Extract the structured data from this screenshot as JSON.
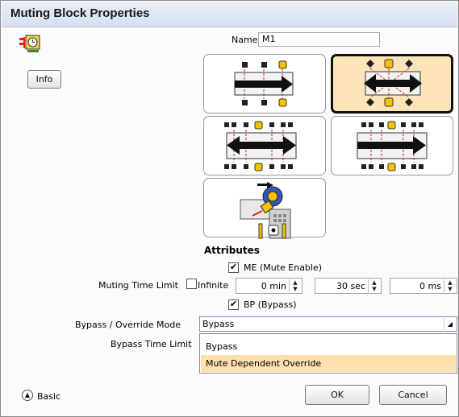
{
  "window": {
    "title": "Muting Block Properties"
  },
  "info_button": "Info",
  "name": {
    "label": "Name",
    "value": "M1"
  },
  "attributes": {
    "heading": "Attributes",
    "mute_enable": {
      "label": "ME (Mute Enable)",
      "checked": true
    },
    "muting_time_limit": {
      "label": "Muting Time Limit",
      "infinite_label": "Infinite",
      "infinite_checked": false,
      "minutes": "0 min",
      "seconds": "30 sec",
      "milliseconds": "0 ms"
    },
    "bypass": {
      "label": "BP (Bypass)",
      "checked": true
    },
    "bypass_override_mode": {
      "label": "Bypass / Override Mode",
      "selected": "Bypass",
      "options": [
        "Bypass",
        "Mute Dependent Override"
      ]
    },
    "bypass_time_limit": {
      "label": "Bypass Time Limit"
    }
  },
  "footer": {
    "basic_label": "Basic",
    "ok_label": "OK",
    "cancel_label": "Cancel"
  },
  "colors": {
    "selected_tile": "#fde4b8",
    "highlight": "#fde0ad",
    "sensor_yellow": "#f4c400"
  }
}
